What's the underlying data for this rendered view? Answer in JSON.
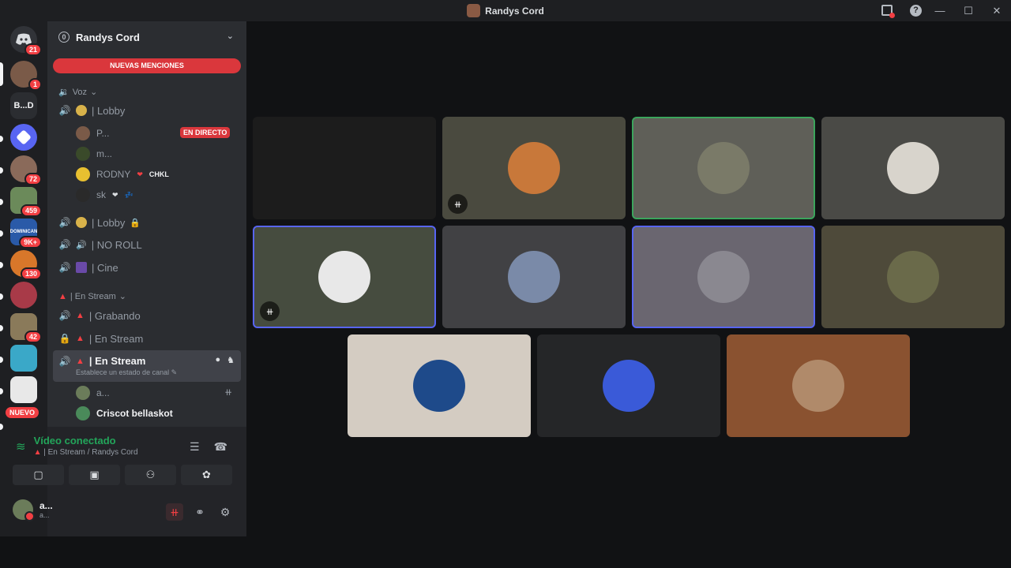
{
  "window": {
    "title": "Randys Cord"
  },
  "rail": {
    "home_badge": "21",
    "servers": [
      {
        "badge": "1",
        "color": "#7a5a48"
      },
      {
        "label": "B...D",
        "color": "#2b2d31"
      },
      {
        "badge": "",
        "color": "#5865f2"
      },
      {
        "badge": "72",
        "color": "#8a6a5a"
      },
      {
        "badge": "459",
        "color": "#6b8a5a"
      },
      {
        "label": "DOMINICAN",
        "badge": "9K+",
        "color": "#2a5aa8"
      },
      {
        "badge": "130",
        "color": "#d8772a"
      },
      {
        "badge": "",
        "color": "#a83a48"
      },
      {
        "badge": "42",
        "color": "#8a7a5a"
      },
      {
        "badge": "",
        "color": "#3aa8c8"
      },
      {
        "badge": "",
        "color": "#e8e8e8"
      }
    ],
    "new_label": "NUEVO"
  },
  "guild": {
    "name": "Randys Cord",
    "count": "0",
    "new_mentions": "NUEVAS MENCIONES",
    "categories": [
      {
        "name": "Voz"
      },
      {
        "name": "| En Stream"
      }
    ],
    "channels": [
      {
        "name": "| Lobby"
      },
      {
        "name": "| Lobby"
      },
      {
        "name": "| NO ROLL"
      },
      {
        "name": "| Cine"
      },
      {
        "name": "| Grabando"
      },
      {
        "name": "| En Stream"
      },
      {
        "name": "| En Stream",
        "status": "Establece un estado de canal"
      }
    ],
    "lobby_users": [
      {
        "name": "P...",
        "live": "EN DIRECTO"
      },
      {
        "name": "m..."
      },
      {
        "name": "RODNY",
        "tag": "CHKL"
      },
      {
        "name": "sk",
        "tag": "💤"
      }
    ],
    "stream_users": [
      {
        "name": "a..."
      },
      {
        "name": "Criscot bellaskot"
      }
    ]
  },
  "voice": {
    "status": "Vídeo conectado",
    "location": "| En Stream / Randys Cord"
  },
  "user": {
    "name": "a...",
    "status": "a..."
  },
  "tiles": [
    {
      "color": "#1c1c1c",
      "face": "#2a2a2a",
      "muted": false,
      "border": "none"
    },
    {
      "color": "#4a4a3f",
      "face": "#c8783a",
      "muted": true,
      "border": "none"
    },
    {
      "color": "#5f5f58",
      "face": "#7a7a68",
      "muted": false,
      "border": "#3ba55c"
    },
    {
      "color": "#4a4a46",
      "face": "#d8d4cc",
      "muted": false,
      "border": "none"
    },
    {
      "color": "#464c3f",
      "face": "#e8e8e8",
      "muted": true,
      "border": "#5865f2"
    },
    {
      "color": "#414144",
      "face": "#7a8aa8",
      "muted": false,
      "border": "none"
    },
    {
      "color": "#6a6670",
      "face": "#8a8890",
      "muted": false,
      "border": "#5865f2"
    },
    {
      "color": "#4e4a3a",
      "face": "#6a6a4a",
      "muted": false,
      "border": "none"
    },
    {
      "color": "#d4ccc2",
      "face": "#1e4a8a",
      "muted": false,
      "border": "none"
    },
    {
      "color": "#252628",
      "face": "#3a5ad8",
      "muted": false,
      "border": "none"
    },
    {
      "color": "#8a5230",
      "face": "#b08a6a",
      "muted": false,
      "border": "none"
    }
  ]
}
